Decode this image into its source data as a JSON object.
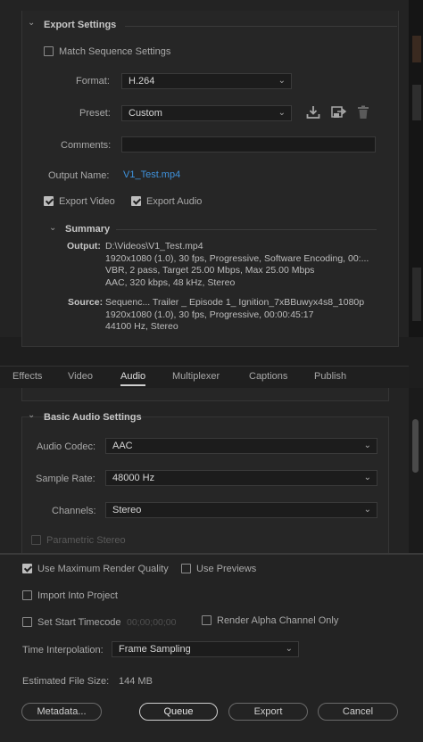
{
  "export_settings": {
    "header": "Export Settings",
    "match_sequence_label": "Match Sequence Settings",
    "format_label": "Format:",
    "format_value": "H.264",
    "preset_label": "Preset:",
    "preset_value": "Custom",
    "comments_label": "Comments:",
    "comments_value": "",
    "output_name_label": "Output Name:",
    "output_name_value": "V1_Test.mp4",
    "export_video_label": "Export Video",
    "export_audio_label": "Export Audio",
    "export_video_checked": true,
    "export_audio_checked": true,
    "match_sequence_checked": false
  },
  "summary": {
    "header": "Summary",
    "output_label": "Output:",
    "output_lines": [
      "D:\\Videos\\V1_Test.mp4",
      "1920x1080 (1.0), 30 fps, Progressive, Software Encoding, 00:...",
      "VBR, 2 pass, Target 25.00 Mbps, Max 25.00 Mbps",
      "AAC, 320 kbps, 48 kHz, Stereo"
    ],
    "source_label": "Source:",
    "source_lines": [
      "Sequenc... Trailer _ Episode 1_ Ignition_7xBBuwyx4s8_1080p",
      "1920x1080 (1.0), 30 fps, Progressive, 00:00:45:17",
      "44100 Hz, Stereo"
    ]
  },
  "tabs": [
    {
      "label": "Effects",
      "active": false
    },
    {
      "label": "Video",
      "active": false
    },
    {
      "label": "Audio",
      "active": true
    },
    {
      "label": "Multiplexer",
      "active": false
    },
    {
      "label": "Captions",
      "active": false
    },
    {
      "label": "Publish",
      "active": false
    }
  ],
  "audio": {
    "header": "Basic Audio Settings",
    "codec_label": "Audio Codec:",
    "codec_value": "AAC",
    "sample_rate_label": "Sample Rate:",
    "sample_rate_value": "48000 Hz",
    "channels_label": "Channels:",
    "channels_value": "Stereo",
    "parametric_stereo_label": "Parametric Stereo"
  },
  "render_options": {
    "max_quality_label": "Use Maximum Render Quality",
    "max_quality_checked": true,
    "use_previews_label": "Use Previews",
    "import_label": "Import Into Project",
    "start_timecode_label": "Set Start Timecode",
    "start_timecode_value": "00;00;00;00",
    "alpha_only_label": "Render Alpha Channel Only",
    "time_interp_label": "Time Interpolation:",
    "time_interp_value": "Frame Sampling",
    "est_size_label": "Estimated File Size:",
    "est_size_value": "144 MB"
  },
  "buttons": {
    "metadata": "Metadata...",
    "queue": "Queue",
    "export": "Export",
    "cancel": "Cancel"
  },
  "icons": {
    "save_preset": "download-icon",
    "import_preset": "import-preset-icon",
    "delete_preset": "trash-icon"
  }
}
